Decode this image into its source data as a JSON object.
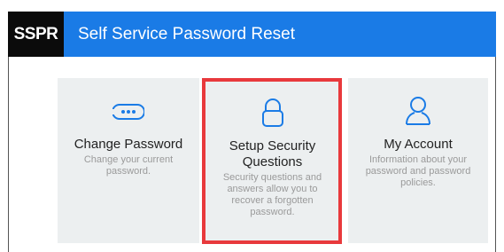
{
  "header": {
    "logo": "SSPR",
    "title": "Self Service Password Reset"
  },
  "tiles": [
    {
      "title": "Change Password",
      "description": "Change your current password.",
      "icon": "password-dots-icon"
    },
    {
      "title": "Setup Security Questions",
      "description": "Security questions and answers allow you to recover a forgotten password.",
      "icon": "lock-icon"
    },
    {
      "title": "My Account",
      "description": "Information about your password and password policies.",
      "icon": "user-icon"
    }
  ],
  "colors": {
    "header_blue": "#1a7be6",
    "logo_black": "#0b0b0b",
    "tile_bg": "#eceff0",
    "icon_blue": "#1a7be6",
    "highlight_red": "#e8393c"
  }
}
